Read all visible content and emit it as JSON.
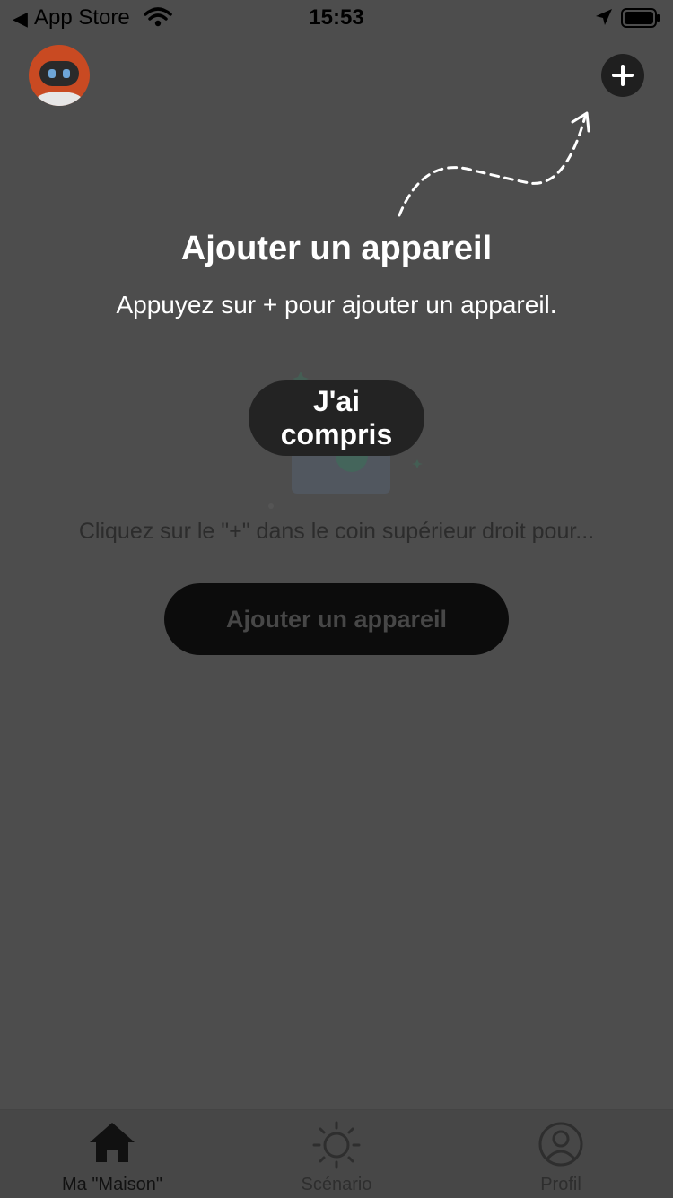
{
  "status_bar": {
    "back_app": "App Store",
    "time": "15:53"
  },
  "header": {
    "avatar_icon": "robot-avatar-icon",
    "add_icon": "plus-icon"
  },
  "coach": {
    "title": "Ajouter un appareil",
    "description": "Appuyez sur + pour ajouter un appareil.",
    "got_it_label": "J'ai compris"
  },
  "empty_state": {
    "hint": "Cliquez sur le \"+\" dans le coin supérieur droit pour...",
    "add_device_label": "Ajouter un appareil"
  },
  "tabs": [
    {
      "label": "Ma \"Maison\"",
      "icon": "home-icon",
      "active": true
    },
    {
      "label": "Scénario",
      "icon": "sun-icon",
      "active": false
    },
    {
      "label": "Profil",
      "icon": "user-circle-icon",
      "active": false
    }
  ],
  "colors": {
    "overlay_bg": "#4d4d4d",
    "button_dark": "#232323",
    "accent_avatar": "#c94a22"
  }
}
